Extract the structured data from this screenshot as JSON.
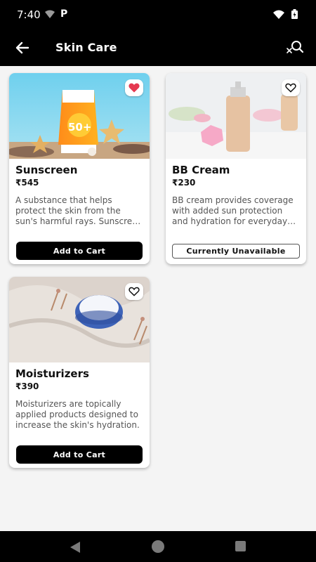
{
  "status": {
    "time": "7:40",
    "carrier": "P"
  },
  "appbar": {
    "title": "Skin Care",
    "back_icon": "arrow-left-icon",
    "search_icon": "search-clear-icon"
  },
  "products": [
    {
      "name": "Sunscreen",
      "price": "₹545",
      "description": "A substance that helps protect the skin from the sun's harmful rays. Sunscreen is applied to the skin to prevent sunburn and damage.",
      "button": "Add to Cart",
      "favorite": true,
      "image_label": "50+"
    },
    {
      "name": "BB Cream",
      "price": "₹230",
      "description": "BB cream provides coverage with added sun protection and hydration for everyday wear.",
      "button": "Currently Unavailable",
      "favorite": false
    },
    {
      "name": "Moisturizers",
      "price": "₹390",
      "description": "Moisturizers are topically applied products designed to increase the skin's hydration.",
      "button": "Add to Cart",
      "favorite": false
    }
  ],
  "colors": {
    "accent": "#000000",
    "favorite": "#e53950",
    "background": "#f4f4f4"
  }
}
